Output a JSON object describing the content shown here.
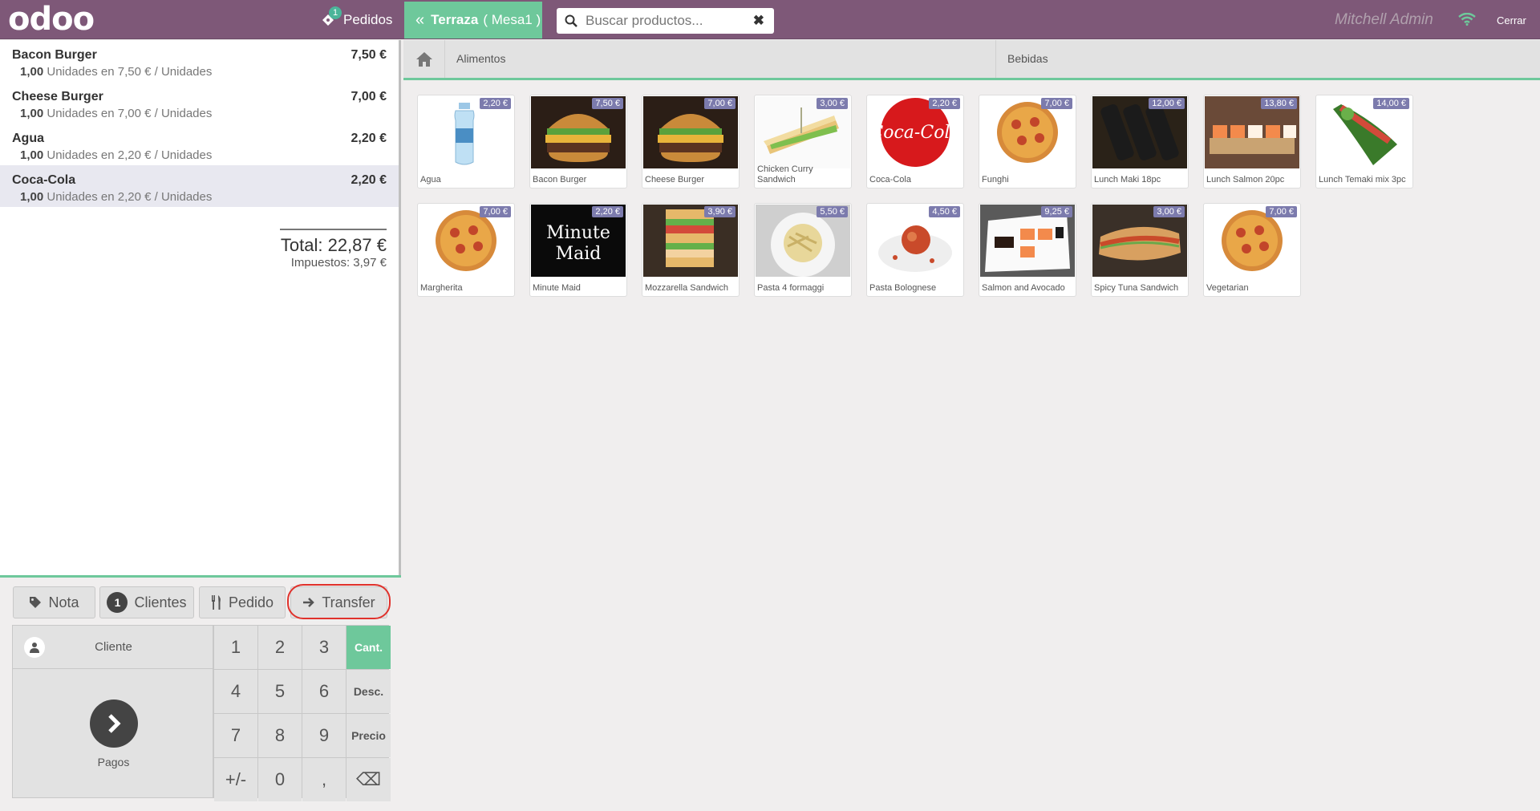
{
  "header": {
    "logo": "odoo",
    "orders_label": "Pedidos",
    "orders_count": "1",
    "table_floor": "Terraza",
    "table_name": "( Mesa1 )",
    "search_placeholder": "Buscar productos...",
    "username": "Mitchell Admin",
    "close_label": "Cerrar"
  },
  "orderlines": [
    {
      "name": "Bacon Burger",
      "price": "7,50 €",
      "qty": "1,00",
      "info": "Unidades en 7,50 € / Unidades"
    },
    {
      "name": "Cheese Burger",
      "price": "7,00 €",
      "qty": "1,00",
      "info": "Unidades en 7,00 € / Unidades"
    },
    {
      "name": "Agua",
      "price": "2,20 €",
      "qty": "1,00",
      "info": "Unidades en 2,20 € / Unidades"
    },
    {
      "name": "Coca-Cola",
      "price": "2,20 €",
      "qty": "1,00",
      "info": "Unidades en 2,20 € / Unidades"
    }
  ],
  "summary": {
    "total": "Total: 22,87 €",
    "taxes": "Impuestos: 3,97 €"
  },
  "control_buttons": {
    "note": "Nota",
    "guests_count": "1",
    "guests": "Clientes",
    "order": "Pedido",
    "transfer": "Transfer"
  },
  "actionpad": {
    "customer": "Cliente",
    "payment": "Pagos"
  },
  "numpad": {
    "keys": [
      "1",
      "2",
      "3",
      "Cant.",
      "4",
      "5",
      "6",
      "Desc.",
      "7",
      "8",
      "9",
      "Precio",
      "+/-",
      "0",
      ",",
      "⌫"
    ],
    "active_mode": "Cant."
  },
  "categories": {
    "home_icon": "home-icon",
    "items": [
      "Alimentos",
      "Bebidas"
    ]
  },
  "products": [
    {
      "name": "Agua",
      "price": "2,20 €",
      "icon": "water-bottle"
    },
    {
      "name": "Bacon Burger",
      "price": "7,50 €",
      "icon": "burger"
    },
    {
      "name": "Cheese Burger",
      "price": "7,00 €",
      "icon": "burger"
    },
    {
      "name": "Chicken Curry Sandwich",
      "price": "3,00 €",
      "icon": "sandwich"
    },
    {
      "name": "Coca-Cola",
      "price": "2,20 €",
      "icon": "coca-cola"
    },
    {
      "name": "Funghi",
      "price": "7,00 €",
      "icon": "pizza"
    },
    {
      "name": "Lunch Maki 18pc",
      "price": "12,00 €",
      "icon": "maki"
    },
    {
      "name": "Lunch Salmon 20pc",
      "price": "13,80 €",
      "icon": "sushi"
    },
    {
      "name": "Lunch Temaki mix 3pc",
      "price": "14,00 €",
      "icon": "temaki"
    },
    {
      "name": "Margherita",
      "price": "7,00 €",
      "icon": "pizza"
    },
    {
      "name": "Minute Maid",
      "price": "2,20 €",
      "icon": "minute-maid"
    },
    {
      "name": "Mozzarella Sandwich",
      "price": "3,90 €",
      "icon": "club-sandwich"
    },
    {
      "name": "Pasta 4 formaggi",
      "price": "5,50 €",
      "icon": "pasta"
    },
    {
      "name": "Pasta Bolognese",
      "price": "4,50 €",
      "icon": "pasta-bolognese"
    },
    {
      "name": "Salmon and Avocado",
      "price": "9,25 €",
      "icon": "sushi-plate"
    },
    {
      "name": "Spicy Tuna Sandwich",
      "price": "3,00 €",
      "icon": "panini"
    },
    {
      "name": "Vegetarian",
      "price": "7,00 €",
      "icon": "pizza"
    }
  ],
  "colors": {
    "header": "#7e5878",
    "accent": "#6ec89b",
    "price_tag": "#7c7bad",
    "highlight": "#e0322c"
  }
}
